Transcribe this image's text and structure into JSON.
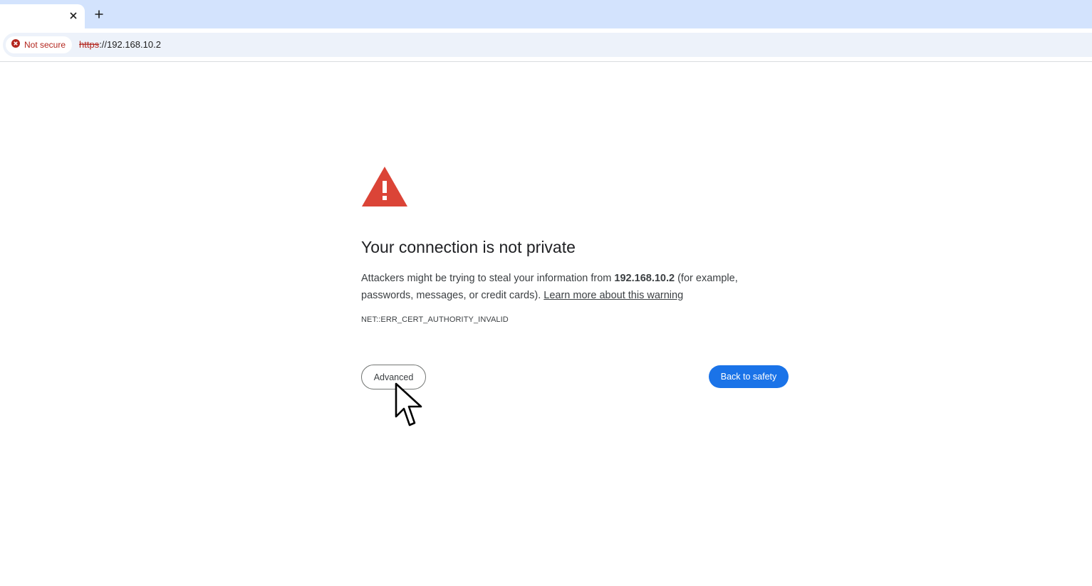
{
  "tab": {
    "title": "",
    "close_icon": "close-icon",
    "new_tab_icon": "plus-icon"
  },
  "omnibox": {
    "security_chip": {
      "icon": "error-circle-icon",
      "label": "Not secure"
    },
    "url_scheme": "https",
    "url_rest": "://192.168.10.2"
  },
  "interstitial": {
    "icon": "warning-triangle-icon",
    "headline": "Your connection is not private",
    "explanation_prefix": "Attackers might be trying to steal your information from ",
    "host": "192.168.10.2",
    "explanation_suffix": " (for example, passwords, messages, or credit cards). ",
    "learn_more": "Learn more about this warning",
    "error_code": "NET::ERR_CERT_AUTHORITY_INVALID",
    "advanced_button": "Advanced",
    "back_button": "Back to safety"
  },
  "colors": {
    "tabstrip_bg": "#d3e3fd",
    "omnibox_bg": "#edf2fa",
    "not_secure_red": "#b3261e",
    "warning_red": "#db4437",
    "primary_blue": "#1a73e8"
  }
}
